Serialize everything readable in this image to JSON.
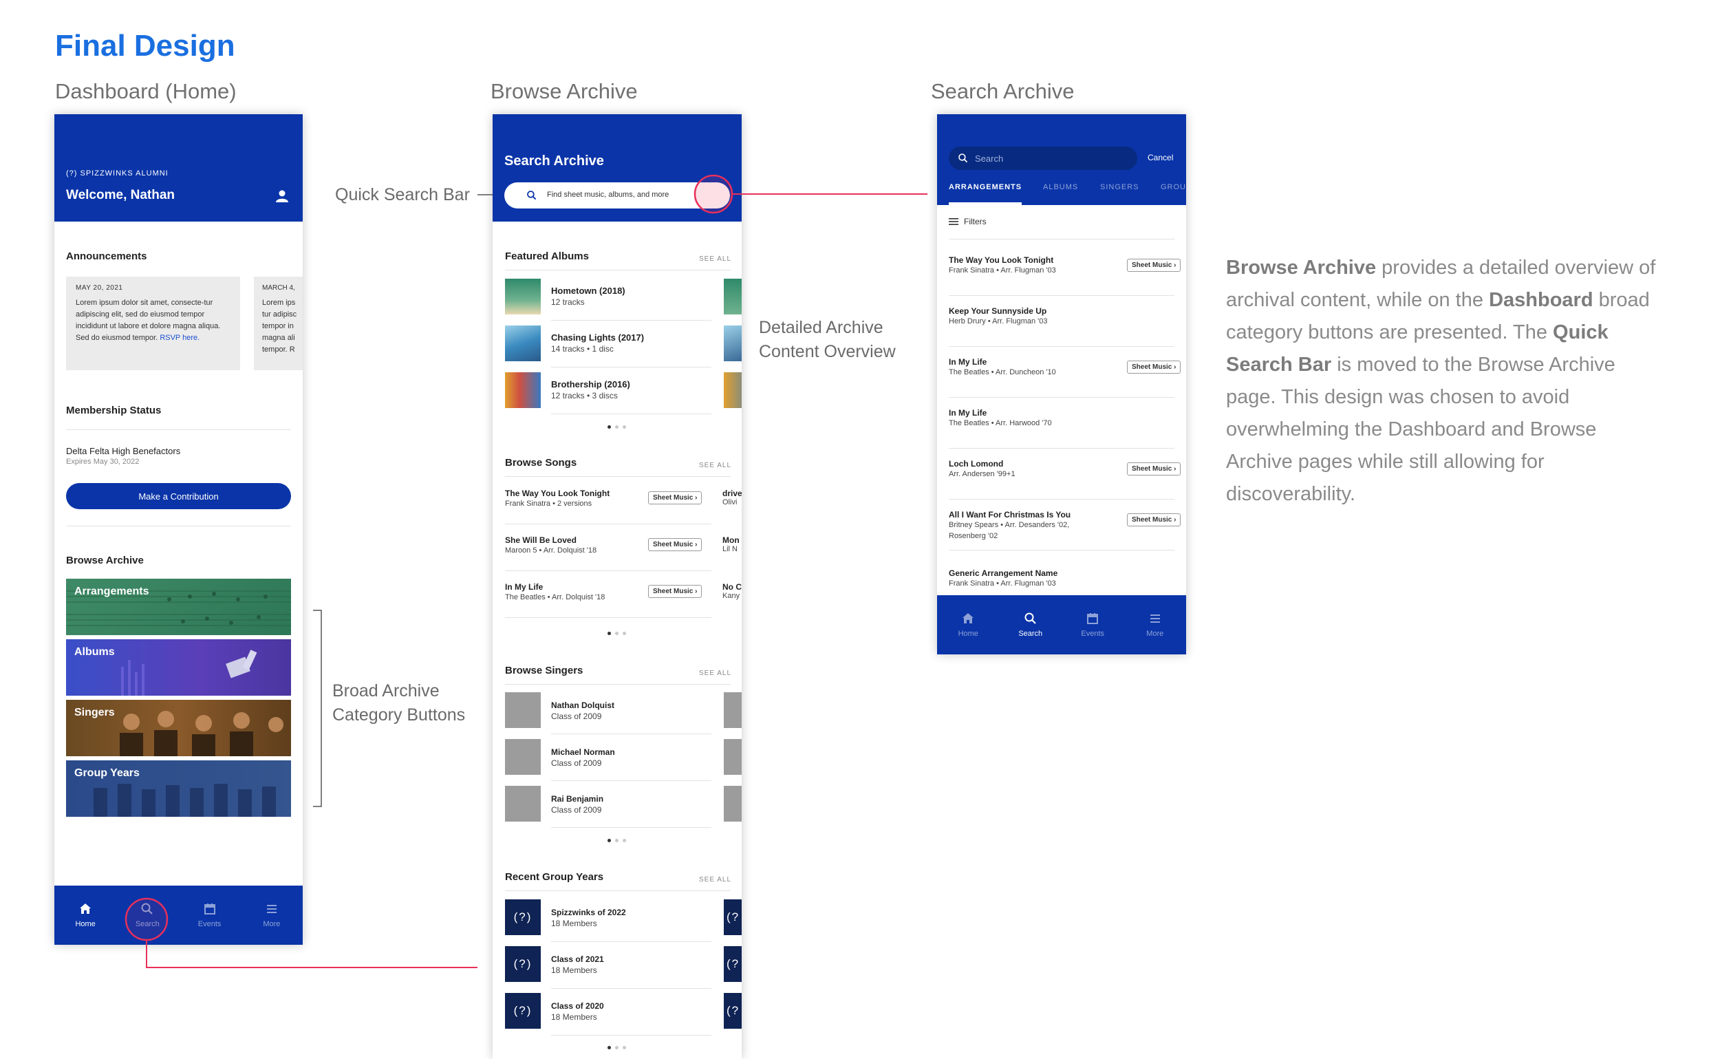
{
  "title": "Final Design",
  "sections": {
    "dashboard": "Dashboard (Home)",
    "browse": "Browse Archive",
    "search": "Search Archive"
  },
  "annotations": {
    "quick_search": "Quick Search Bar",
    "detailed_1": "Detailed Archive",
    "detailed_2": "Content Overview",
    "broad_1": "Broad Archive",
    "broad_2": "Category Buttons"
  },
  "description": {
    "b1": "Browse Archive",
    "t1": " provides a detailed overview of archival content, while on the ",
    "b2": "Dashboard",
    "t2": " broad category buttons are presented. The ",
    "b3": "Quick Search Bar",
    "t3": " is moved to the Browse Archive page. This design was chosen to avoid overwhelming the Dashboard and Browse Archive pages while still allowing for discoverability."
  },
  "tabs": {
    "home": "Home",
    "search": "Search",
    "events": "Events",
    "more": "More"
  },
  "dashboard": {
    "org": "(?) SPIZZWINKS ALUMNI",
    "welcome": "Welcome, Nathan",
    "announcements_h": "Announcements",
    "card1_date": "MAY 20, 2021",
    "card1_text": "Lorem ipsum dolor sit amet, consecte-tur adipiscing elit, sed do eiusmod tempor incididunt ut labore et dolore magna aliqua.  Sed do eiusmod tempor.",
    "card1_link": "RSVP here.",
    "card2_date": "MARCH 4,",
    "card2_text": "Lorem ips tur adipisc tempor in magna ali tempor. R",
    "membership_h": "Membership Status",
    "membership_name": "Delta Felta High Benefactors",
    "membership_exp": "Expires May 30, 2022",
    "contribute": "Make a Contribution",
    "browse_h": "Browse Archive",
    "categories": [
      "Arrangements",
      "Albums",
      "Singers",
      "Group Years"
    ]
  },
  "browse": {
    "header": "Search Archive",
    "search_placeholder": "Find sheet music, albums, and more",
    "see_all": "SEE ALL",
    "featured_h": "Featured Albums",
    "albums": [
      {
        "title": "Hometown (2018)",
        "sub": "12 tracks"
      },
      {
        "title": "Chasing Lights (2017)",
        "sub": "14 tracks • 1 disc"
      },
      {
        "title": "Brothership (2016)",
        "sub": "12 tracks • 3 discs"
      }
    ],
    "songs_h": "Browse Songs",
    "songs": [
      {
        "title": "The Way You Look Tonight",
        "sub": "Frank Sinatra • 2 versions",
        "btn": "Sheet Music"
      },
      {
        "title": "She Will Be Loved",
        "sub": "Maroon 5 • Arr. Dolquist '18",
        "btn": "Sheet Music"
      },
      {
        "title": "In My Life",
        "sub": "The Beatles • Arr. Dolquist '18",
        "btn": "Sheet Music"
      }
    ],
    "songs_peek": [
      {
        "a": "drive",
        "b": "Olivi"
      },
      {
        "a": "Mon",
        "b": "Lil N"
      },
      {
        "a": "No C",
        "b": "Kany"
      }
    ],
    "singers_h": "Browse Singers",
    "singers": [
      {
        "name": "Nathan Dolquist",
        "sub": "Class of 2009"
      },
      {
        "name": "Michael Norman",
        "sub": "Class of 2009"
      },
      {
        "name": "Rai Benjamin",
        "sub": "Class of 2009"
      }
    ],
    "years_h": "Recent Group Years",
    "years_icon": "(?)",
    "years_peek_icon": "(?",
    "years": [
      {
        "name": "Spizzwinks of 2022",
        "sub": "18 Members"
      },
      {
        "name": "Class of 2021",
        "sub": "18 Members"
      },
      {
        "name": "Class of 2020",
        "sub": "18 Members"
      }
    ]
  },
  "search": {
    "placeholder": "Search",
    "cancel": "Cancel",
    "tabs": [
      "ARRANGEMENTS",
      "ALBUMS",
      "SINGERS",
      "GROU"
    ],
    "filters": "Filters",
    "btn": "Sheet Music",
    "results": [
      {
        "title": "The Way You Look Tonight",
        "sub": "Frank Sinatra • Arr. Flugman '03",
        "sub2": "",
        "btn": true
      },
      {
        "title": "Keep Your Sunnyside Up",
        "sub": "Herb Drury • Arr. Flugman '03",
        "sub2": "",
        "btn": false
      },
      {
        "title": "In My Life",
        "sub": "The Beatles • Arr. Duncheon '10",
        "sub2": "",
        "btn": true
      },
      {
        "title": "In My Life",
        "sub": "The Beatles • Arr. Harwood '70",
        "sub2": "",
        "btn": false
      },
      {
        "title": "Loch Lomond",
        "sub": "Arr. Andersen '99+1",
        "sub2": "",
        "btn": true
      },
      {
        "title": "All I Want For Christmas Is You",
        "sub": "Britney Spears • Arr. Desanders '02,",
        "sub2": "Rosenberg '02",
        "btn": true
      },
      {
        "title": "Generic Arrangement Name",
        "sub": "Frank Sinatra • Arr. Flugman '03",
        "sub2": "",
        "btn": false
      }
    ]
  },
  "colors": {
    "accent": "#1a6fe0",
    "navy": "#0a34a8",
    "highlight": "#e8305a"
  }
}
